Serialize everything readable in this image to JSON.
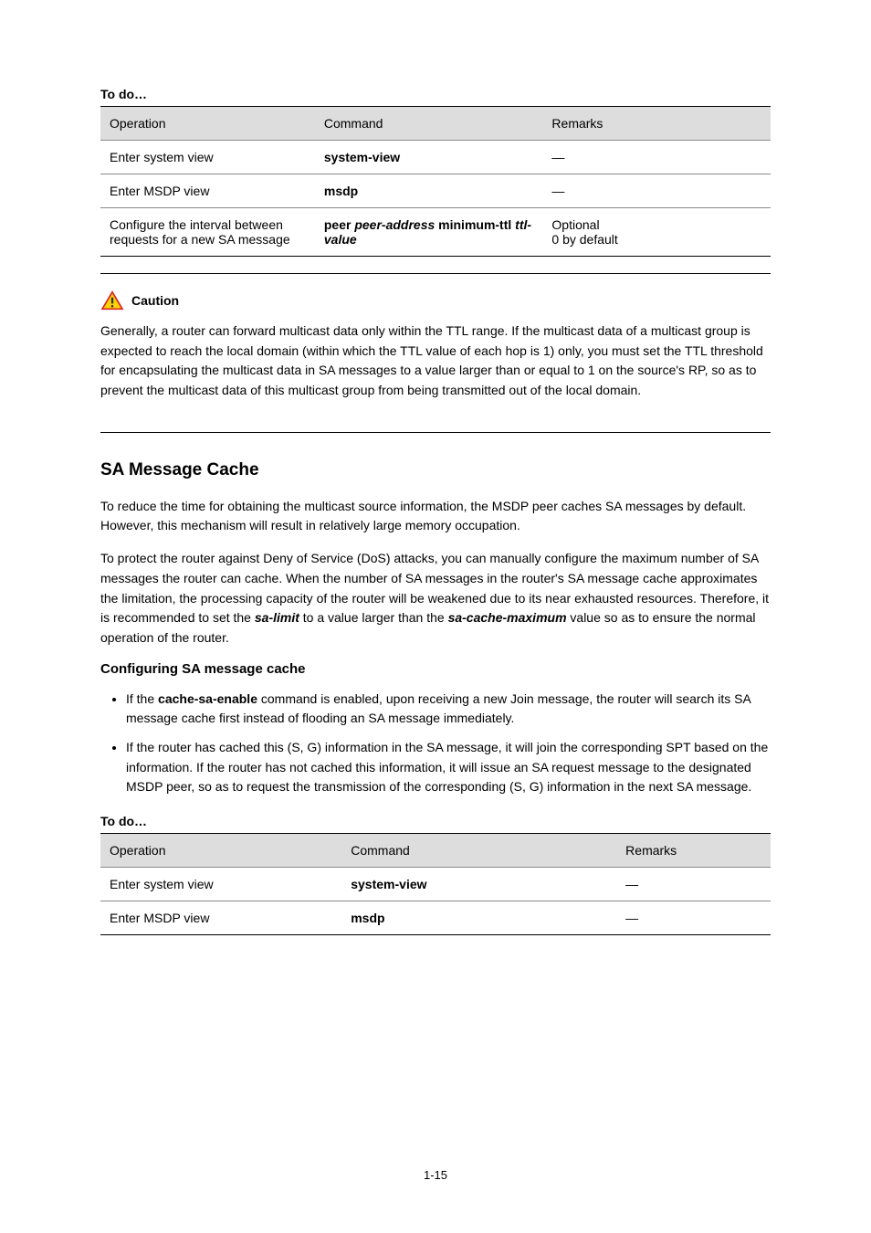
{
  "label1": "To do…",
  "table1": {
    "headers": [
      "Operation",
      "Command",
      "Remarks"
    ],
    "rows": [
      [
        {
          "text": "Enter system view"
        },
        {
          "text": "system-view",
          "cls": "bold"
        },
        {
          "text": "—"
        }
      ],
      [
        {
          "text": "Enter MSDP view"
        },
        {
          "text": "msdp",
          "cls": "bold"
        },
        {
          "text": "—"
        }
      ],
      [
        {
          "text": "Configure the interval between requests for a new SA message"
        },
        {
          "html": "<span class='bold'>peer</span> <span class='boldit'>peer-address</span> <span class='bold'>minimum-ttl</span> <span class='boldit'>ttl-value</span>"
        },
        {
          "text": "Optional\n0 by default"
        }
      ]
    ]
  },
  "callout": {
    "title": "Caution",
    "body": "Generally, a router can forward multicast data only within the TTL range. If the multicast data of a multicast group is expected to reach the local domain (within which the TTL value of each hop is 1) only, you must set the TTL threshold for encapsulating the multicast data in SA messages to a value larger than or equal to 1 on the source's RP, so as to prevent the multicast data of this multicast group from being transmitted out of the local domain."
  },
  "section_title": "SA Message Cache",
  "section_p1": "To reduce the time for obtaining the multicast source information, the MSDP peer caches SA messages by default. However, this mechanism will result in relatively large memory occupation.",
  "section_p2_prefix": "To protect the router against Deny of Service (DoS) attacks, you can manually configure the maximum number of SA messages the router can cache. When the number of SA messages in the router's SA message cache approximates the limitation, the processing capacity of the router will be weakened due to its near exhausted resources. Therefore, it is recommended to set the ",
  "section_p2_italic": "sa-limit",
  "section_p2_mid": " to a value larger than the ",
  "section_p2_italic2": "sa-cache-maximum",
  "section_p2_suffix": " value so as to ensure the normal operation of the router.",
  "sub_title": "Configuring SA message cache",
  "bullets": [
    {
      "prefix": "If the ",
      "bold": "cache-sa-enable",
      "suffix": " command is enabled, upon receiving a new Join message, the router will search its SA message cache first instead of flooding an SA message immediately."
    },
    {
      "prefix": "If the router has cached this (S, G) information in the SA message, it will join the corresponding SPT based on the information. If the router has not cached this information, it will issue an SA request message to the designated MSDP peer, so as to request the transmission of the corresponding (S, G) information in the next SA message.",
      "bold": "",
      "suffix": ""
    }
  ],
  "label2": "To do…",
  "table2": {
    "headers": [
      "Operation",
      "Command",
      "Remarks"
    ],
    "rows": [
      [
        {
          "text": "Enter system view"
        },
        {
          "text": "system-view",
          "cls": "bold"
        },
        {
          "text": "—"
        }
      ],
      [
        {
          "text": "Enter MSDP view"
        },
        {
          "text": "msdp",
          "cls": "bold"
        },
        {
          "text": "—"
        }
      ]
    ]
  },
  "page_number": "1-15"
}
